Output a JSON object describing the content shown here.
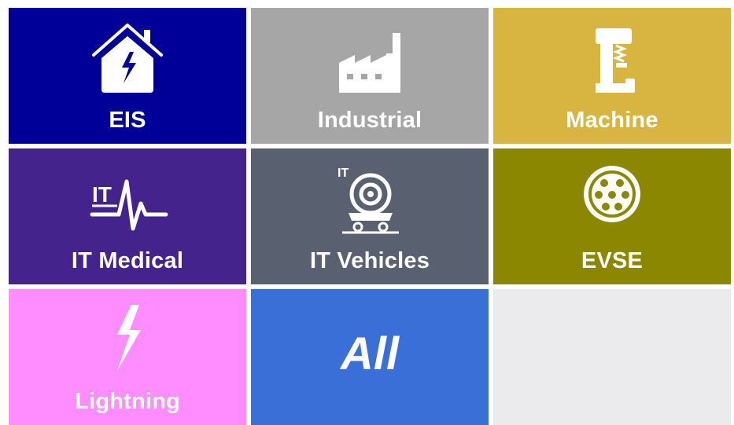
{
  "tiles": [
    {
      "key": "eis",
      "label": "EIS",
      "color": "#000099",
      "icon": "house-lightning-icon"
    },
    {
      "key": "industrial",
      "label": "Industrial",
      "color": "#a6a6a6",
      "icon": "factory-icon"
    },
    {
      "key": "machine",
      "label": "Machine",
      "color": "#d8b440",
      "icon": "machine-press-icon"
    },
    {
      "key": "it-medical",
      "label": "IT Medical",
      "color": "#45238c",
      "icon": "it-heartbeat-icon"
    },
    {
      "key": "it-vehicles",
      "label": "IT Vehicles",
      "color": "#596070",
      "icon": "it-vehicle-wheel-icon"
    },
    {
      "key": "evse",
      "label": "EVSE",
      "color": "#8b8700",
      "icon": "ev-connector-icon"
    },
    {
      "key": "lightning",
      "label": "Lightning",
      "color": "#ff8dff",
      "icon": "lightning-bolt-icon"
    },
    {
      "key": "all",
      "label": "All",
      "color": "#3b6fd8",
      "icon": ""
    },
    {
      "key": "empty",
      "label": "",
      "color": "#ebebed",
      "icon": ""
    }
  ],
  "icon_text": {
    "it_small": "IT"
  }
}
